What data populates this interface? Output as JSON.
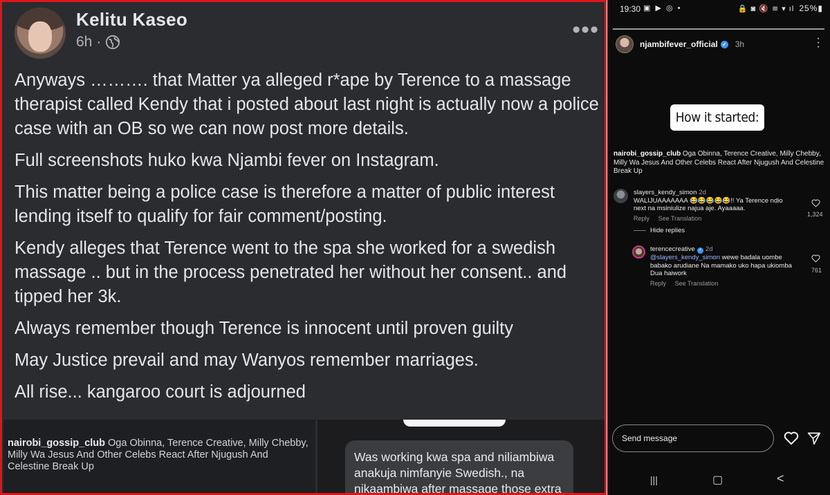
{
  "facebook": {
    "author": "Kelitu Kaseo",
    "time": "6h",
    "separator": "·",
    "more": "•••",
    "paragraphs": [
      "Anyways ………. that Matter ya alleged r*ape by Terence to a massage therapist called Kendy that i posted about last night is actually now a police case with an OB so we can now post more details.",
      "Full screenshots huko kwa Njambi fever on Instagram.",
      "This matter being a police case is therefore a matter of public interest lending itself to qualify for fair comment/posting.",
      "Kendy alleges that Terence went to the spa she worked for a swedish massage .. but in the process penetrated her without her consent.. and tipped her 3k.",
      "Always remember though Terence  is innocent until proven guilty",
      "May Justice prevail and may Wanyos remember marriages.",
      "All rise... kangaroo court is adjourned"
    ],
    "embed_left": {
      "account": "nairobi_gossip_club",
      "text": "Oga Obinna, Terence Creative, Milly Chebby, Milly Wa Jesus And Other Celebs React After Njugush And Celestine Break Up"
    },
    "embed_right": {
      "message": "Was working kwa spa and niliambiwa anakuja nimfanyie Swedish., na nikaambiwa after massage those extra"
    }
  },
  "instagram": {
    "status": {
      "time": "19:30",
      "left_icons": "▣ ▶ ◎ •",
      "right_icons": "🔒 ◙ 🔇 ≋ ▾ ıl",
      "battery": "25%▮"
    },
    "user": "njambifever_official",
    "time": "3h",
    "story_text": "How it started:",
    "caption": {
      "account": "nairobi_gossip_club",
      "text": "Oga Obinna, Terence Creative, Milly Chebby, Milly Wa Jesus And Other Celebs React After Njugush And Celestine Break Up"
    },
    "comments": [
      {
        "handle": "slayers_kendy_simon",
        "age": "2d",
        "text": "WALIJUAAAAAAA 😂😂😂😂😂!! Ya Terence ndio next na msiniulize najua aje. Ayaaaaa.",
        "reply": "Reply",
        "translate": "See Translation",
        "likes": "1,324",
        "hide": "Hide replies"
      },
      {
        "handle": "terencecreative",
        "age": "2d",
        "mention": "@slayers_kendy_simon",
        "text": " wewe badala uombe babako arudiane Na mamako uko hapa ukiomba Dua haiwork",
        "reply": "Reply",
        "translate": "See Translation",
        "likes": "761"
      }
    ],
    "send_placeholder": "Send message",
    "nav": [
      "|||",
      "▢",
      "<"
    ]
  }
}
